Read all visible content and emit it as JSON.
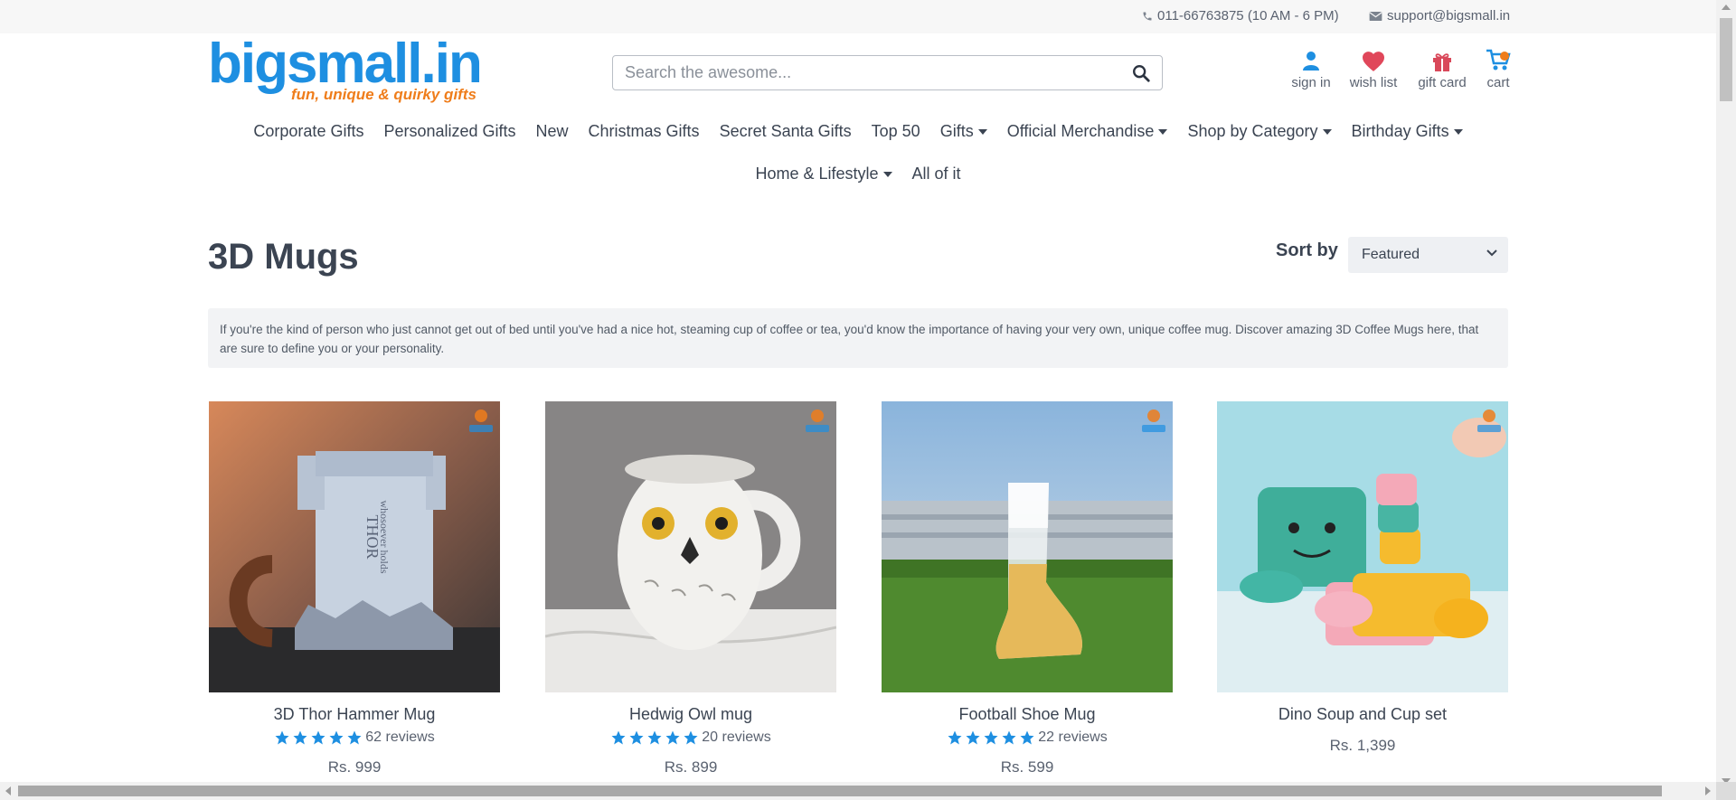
{
  "topbar": {
    "phone": "011-66763875 (10 AM - 6 PM)",
    "email": "support@bigsmall.in"
  },
  "logo": {
    "brand": "bigsmall.in",
    "tagline": "fun, unique & quirky gifts"
  },
  "search": {
    "placeholder": "Search the awesome..."
  },
  "header_actions": {
    "signin": "sign in",
    "wishlist": "wish list",
    "giftcard": "gift card",
    "cart": "cart"
  },
  "nav": {
    "row1": [
      {
        "label": "Corporate Gifts",
        "dropdown": false
      },
      {
        "label": "Personalized Gifts",
        "dropdown": false
      },
      {
        "label": "New",
        "dropdown": false
      },
      {
        "label": "Christmas Gifts",
        "dropdown": false
      },
      {
        "label": "Secret Santa Gifts",
        "dropdown": false
      },
      {
        "label": "Top 50",
        "dropdown": false
      },
      {
        "label": "Gifts",
        "dropdown": true
      },
      {
        "label": "Official Merchandise",
        "dropdown": true
      },
      {
        "label": "Shop by Category",
        "dropdown": true
      },
      {
        "label": "Birthday Gifts",
        "dropdown": true
      }
    ],
    "row2": [
      {
        "label": "Home & Lifestyle",
        "dropdown": true
      },
      {
        "label": "All of it",
        "dropdown": false
      }
    ]
  },
  "page": {
    "title": "3D Mugs",
    "sort_label": "Sort by",
    "sort_value": "Featured",
    "description": "If you're the kind of person who just cannot get out of bed until you've had a nice hot, steaming cup of coffee or tea, you'd know the importance of having your very own, unique coffee mug. Discover amazing 3D Coffee Mugs here, that are sure to define you or your personality."
  },
  "products": [
    {
      "name": "3D Thor Hammer Mug",
      "reviews": "62 reviews",
      "stars": 5,
      "price": "Rs. 999"
    },
    {
      "name": "Hedwig Owl mug",
      "reviews": "20 reviews",
      "stars": 5,
      "price": "Rs. 899"
    },
    {
      "name": "Football Shoe Mug",
      "reviews": "22 reviews",
      "stars": 5,
      "price": "Rs. 599"
    },
    {
      "name": "Dino Soup and Cup set",
      "reviews": "",
      "stars": 0,
      "price": "Rs. 1,399"
    }
  ],
  "colors": {
    "brand_blue": "#1e8fe1",
    "brand_orange": "#ef7d1b",
    "star_blue": "#1e8fe1",
    "heart_red": "#e0475a"
  }
}
